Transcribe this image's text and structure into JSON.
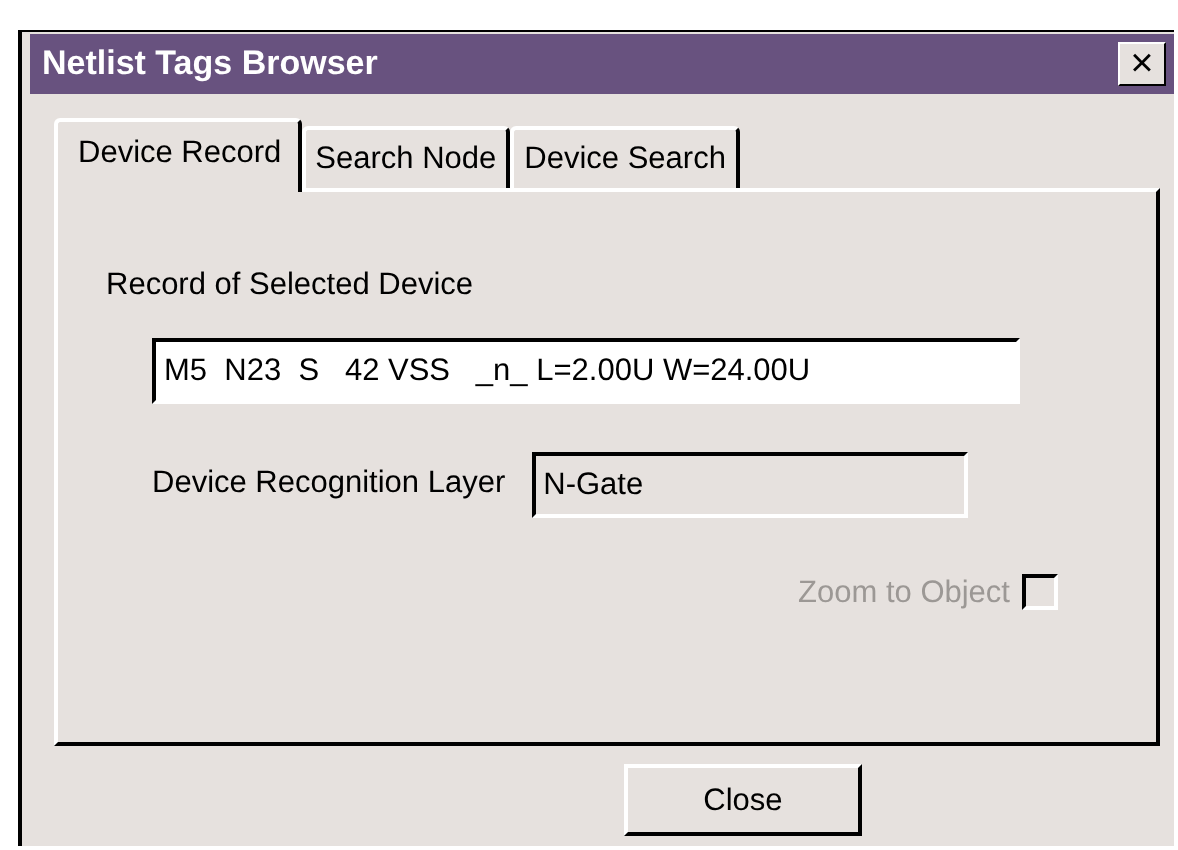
{
  "window": {
    "title": "Netlist Tags Browser",
    "close_glyph": "×"
  },
  "tabs": [
    {
      "label": "Device Record",
      "selected": true
    },
    {
      "label": "Search Node",
      "selected": false
    },
    {
      "label": "Device Search",
      "selected": false
    }
  ],
  "record": {
    "label": "Record of Selected Device",
    "value": "M5  N23  S   42 VSS   _n_ L=2.00U W=24.00U"
  },
  "layer": {
    "label": "Device Recognition Layer",
    "value": "N-Gate",
    "disabled": true
  },
  "zoom_to_object": {
    "label": "Zoom to Object",
    "checked": false,
    "disabled": true
  },
  "buttons": [
    "Close"
  ]
}
